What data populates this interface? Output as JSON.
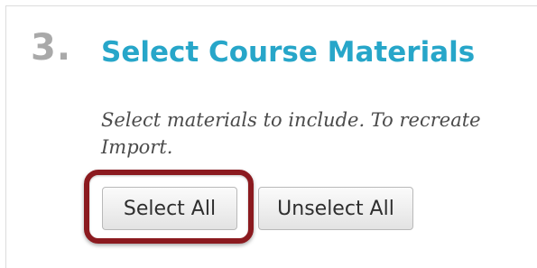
{
  "step": {
    "number": "3.",
    "title": "Select Course Materials"
  },
  "instructions": {
    "line1": "Select materials to include. To recreate",
    "line2": "Import."
  },
  "buttons": {
    "select_all": "Select All",
    "unselect_all": "Unselect All"
  },
  "colors": {
    "title": "#27a6c9",
    "step_number": "#a9a9a9",
    "highlight": "#8b1a1f"
  }
}
